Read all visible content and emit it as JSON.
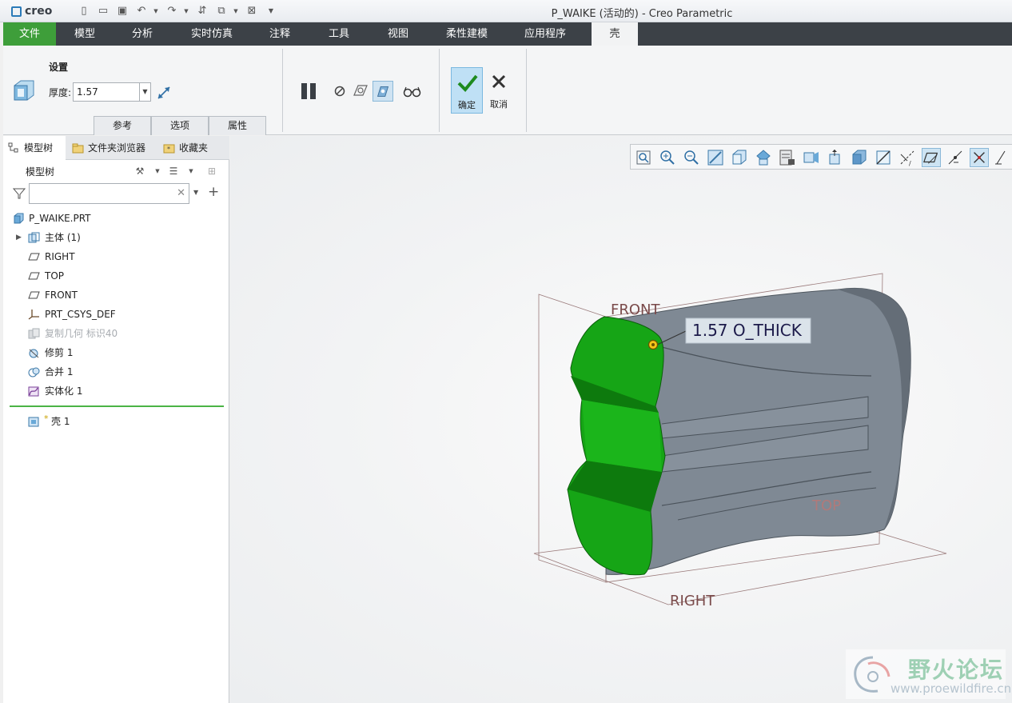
{
  "app": {
    "logo_text": "creo",
    "window_title": "P_WAIKE (活动的) - Creo Parametric"
  },
  "ribbon_tabs": [
    "文件",
    "模型",
    "分析",
    "实时仿真",
    "注释",
    "工具",
    "视图",
    "柔性建模",
    "应用程序",
    "壳"
  ],
  "shell_dashboard": {
    "settings_label": "设置",
    "thickness_label": "厚度:",
    "thickness_value": "1.57",
    "subtabs": [
      "参考",
      "选项",
      "属性"
    ],
    "ok_label": "确定",
    "cancel_label": "取消"
  },
  "navigator": {
    "tabs": [
      "模型树",
      "文件夹浏览器",
      "收藏夹"
    ],
    "tree_title": "模型树",
    "search_placeholder": "",
    "items": [
      {
        "label": "P_WAIKE.PRT",
        "icon": "part-icon",
        "dimmed": false
      },
      {
        "label": "主体 (1)",
        "icon": "body-icon",
        "dimmed": false,
        "expandable": true
      },
      {
        "label": "RIGHT",
        "icon": "datum-plane-icon",
        "dimmed": false
      },
      {
        "label": "TOP",
        "icon": "datum-plane-icon",
        "dimmed": false
      },
      {
        "label": "FRONT",
        "icon": "datum-plane-icon",
        "dimmed": false
      },
      {
        "label": "PRT_CSYS_DEF",
        "icon": "csys-icon",
        "dimmed": false
      },
      {
        "label": "复制几何 标识40",
        "icon": "copy-geometry-icon",
        "dimmed": true
      },
      {
        "label": "修剪 1",
        "icon": "trim-icon",
        "dimmed": false
      },
      {
        "label": "合并 1",
        "icon": "merge-icon",
        "dimmed": false
      },
      {
        "label": "实体化 1",
        "icon": "solidify-icon",
        "dimmed": false
      }
    ],
    "new_feature": {
      "marker": "*",
      "label": "壳 1",
      "icon": "shell-feature-icon"
    }
  },
  "graphics": {
    "datum_labels": {
      "front": "FRONT",
      "top": "TOP",
      "right": "RIGHT"
    },
    "dimension_callout": "1.57 O_THICK",
    "colors": {
      "selected_face": "#16a516",
      "body": "#7d8791",
      "datum_plane": "#7a4a4a"
    }
  },
  "watermark": {
    "title": "野火论坛",
    "url": "www.proewildfire.cn"
  }
}
